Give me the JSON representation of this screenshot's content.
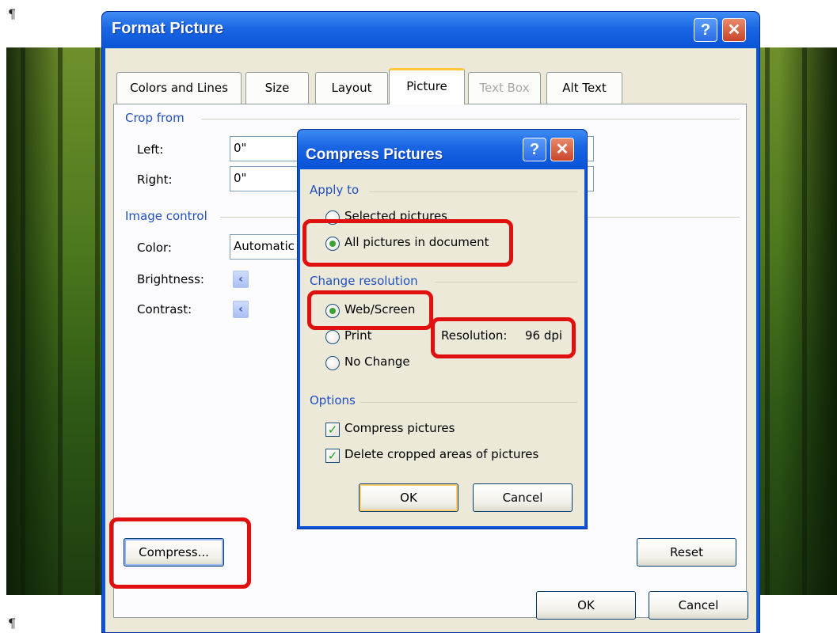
{
  "pilcrow": "¶",
  "format_picture": {
    "title": "Format Picture",
    "help_btn": "?",
    "close_btn": "✕",
    "tabs": [
      {
        "label": "Colors and Lines"
      },
      {
        "label": "Size"
      },
      {
        "label": "Layout"
      },
      {
        "label": "Picture"
      },
      {
        "label": "Text Box"
      },
      {
        "label": "Alt Text"
      }
    ],
    "active_tab": "Picture",
    "disabled_tab": "Text Box",
    "crop_from": {
      "label": "Crop from",
      "left_label": "Left:",
      "left_value": "0\"",
      "right_label": "Right:",
      "right_value": "0\""
    },
    "image_control": {
      "label": "Image control",
      "color_label": "Color:",
      "color_value": "Automatic",
      "brightness_label": "Brightness:",
      "contrast_label": "Contrast:"
    },
    "compress_button": "Compress...",
    "reset_button": "Reset",
    "ok_button": "OK",
    "cancel_button": "Cancel"
  },
  "compress_pictures": {
    "title": "Compress Pictures",
    "help_btn": "?",
    "close_btn": "✕",
    "apply_to": {
      "label": "Apply to",
      "options": [
        "Selected pictures",
        "All pictures in document"
      ],
      "selected": "All pictures in document"
    },
    "change_resolution": {
      "label": "Change resolution",
      "options": [
        "Web/Screen",
        "Print",
        "No Change"
      ],
      "selected": "Web/Screen",
      "resolution_label": "Resolution:",
      "resolution_value": "96 dpi"
    },
    "options": {
      "label": "Options",
      "compress_pictures": "Compress pictures",
      "compress_pictures_checked": true,
      "delete_cropped": "Delete cropped areas of pictures",
      "delete_cropped_checked": true
    },
    "ok_button": "OK",
    "cancel_button": "Cancel"
  },
  "colors": {
    "titlebar": "#0a54d8",
    "dialog_bg": "#ece9d8",
    "group_label": "#1f4fc0",
    "highlight": "#e01010",
    "active_tab_accent": "#ffc83c"
  }
}
